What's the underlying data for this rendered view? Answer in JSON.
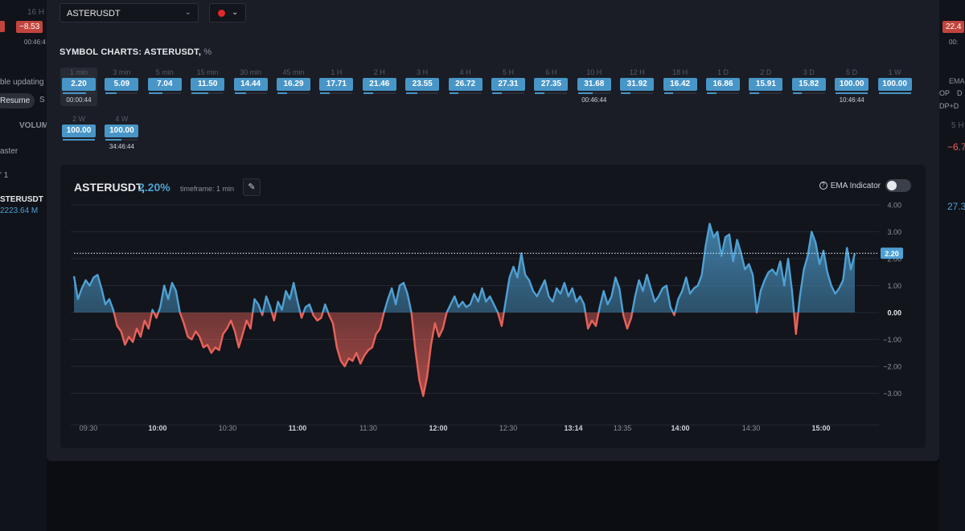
{
  "background": {
    "left": {
      "top_value": "16 H",
      "badge": "−8.53",
      "time": "00:46:4",
      "auto_update": "ble updating",
      "resume_label": "Resume",
      "s_label": "S",
      "volume_label": "VOLUM",
      "master_label": "aster",
      "row_label": "' 1",
      "symbol": "STERUSDT",
      "volume": "2223.64 M"
    },
    "right": {
      "badge": "22.4",
      "time": "00:",
      "ema_label": "EMA",
      "op_label": "OP",
      "d_label": "D",
      "dpd_label": "DP+D",
      "tf_label": "5 H",
      "neg_value": "−6.7",
      "pos_value": "27.3"
    }
  },
  "symbol_select": {
    "value": "ASTERUSDT"
  },
  "color_select": {
    "color": "#e02a2a"
  },
  "section": {
    "title": "SYMBOL CHARTS: ASTERUSDT,",
    "unit": "%"
  },
  "timeframes": [
    {
      "label": "1 min",
      "value": "2.20",
      "progress": 0.72,
      "time": "00:00:44",
      "active": true
    },
    {
      "label": "3 min",
      "value": "5.09",
      "progress": 0.35
    },
    {
      "label": "5 min",
      "value": "7.04",
      "progress": 0.42
    },
    {
      "label": "15 min",
      "value": "11.50",
      "progress": 0.52
    },
    {
      "label": "30 min",
      "value": "14.44",
      "progress": 0.36
    },
    {
      "label": "45 min",
      "value": "16.29",
      "progress": 0.3
    },
    {
      "label": "1 H",
      "value": "17.71",
      "progress": 0.28
    },
    {
      "label": "2 H",
      "value": "21.46",
      "progress": 0.3
    },
    {
      "label": "3 H",
      "value": "23.55",
      "progress": 0.35
    },
    {
      "label": "4 H",
      "value": "26.72",
      "progress": 0.28
    },
    {
      "label": "5 H",
      "value": "27.31",
      "progress": 0.3
    },
    {
      "label": "6 H",
      "value": "27.35",
      "progress": 0.3
    },
    {
      "label": "10 H",
      "value": "31.68",
      "progress": 0.45,
      "time": "00:46:44"
    },
    {
      "label": "12 H",
      "value": "31.92",
      "progress": 0.3
    },
    {
      "label": "18 H",
      "value": "16.42",
      "progress": 0.28
    },
    {
      "label": "1 D",
      "value": "16.86",
      "progress": 0.3
    },
    {
      "label": "2 D",
      "value": "15.91",
      "progress": 0.28
    },
    {
      "label": "3 D",
      "value": "15.82",
      "progress": 0.28
    },
    {
      "label": "5 D",
      "value": "100.00",
      "progress": 1.0,
      "time": "10:46:44"
    },
    {
      "label": "1 W",
      "value": "100.00",
      "progress": 1.0
    },
    {
      "label": "2 W",
      "value": "100.00",
      "progress": 1.0
    },
    {
      "label": "4 W",
      "value": "100.00",
      "progress": 0.5,
      "time": "34:46:44"
    }
  ],
  "panel": {
    "symbol": "ASTERUSDT,",
    "pct": "2.20%",
    "timeframe": "timeframe: 1 min",
    "ema_label": "EMA Indicator",
    "ema_on": false
  },
  "chart_data": {
    "type": "area",
    "title": "",
    "xlabel": "",
    "ylabel": "",
    "ylim": [
      -4,
      4
    ],
    "yticks": [
      "4.00",
      "3.00",
      "2.00",
      "1.00",
      "0.00",
      "−1.00",
      "−2.00",
      "−3.00"
    ],
    "ytick_values": [
      4,
      3,
      2,
      1,
      0,
      -1,
      -2,
      -3
    ],
    "xticks": [
      {
        "label": "09:30",
        "bold": false
      },
      {
        "label": "10:00",
        "bold": true
      },
      {
        "label": "10:30",
        "bold": false
      },
      {
        "label": "11:00",
        "bold": true
      },
      {
        "label": "11:30",
        "bold": false
      },
      {
        "label": "12:00",
        "bold": true
      },
      {
        "label": "12:30",
        "bold": false
      },
      {
        "label": "13:14",
        "bold": true
      },
      {
        "label": "13:35",
        "bold": false
      },
      {
        "label": "14:00",
        "bold": true
      },
      {
        "label": "14:30",
        "bold": false
      },
      {
        "label": "15:00",
        "bold": true
      }
    ],
    "current_value": 2.2,
    "current_label": "2.20",
    "positive_color": "#4fa0d3",
    "negative_color": "#e8625a",
    "grid": true,
    "values": [
      1.35,
      0.5,
      0.9,
      1.2,
      1.0,
      1.3,
      1.4,
      0.9,
      0.3,
      0.5,
      0.1,
      -0.5,
      -0.7,
      -1.2,
      -0.9,
      -1.1,
      -0.6,
      -0.9,
      -0.3,
      -0.6,
      0.1,
      -0.2,
      0.2,
      1.0,
      0.5,
      1.1,
      0.8,
      0.0,
      -0.4,
      -0.9,
      -1.0,
      -0.7,
      -0.9,
      -1.3,
      -1.2,
      -1.5,
      -1.3,
      -1.4,
      -0.8,
      -0.6,
      -0.3,
      -0.7,
      -1.3,
      -0.8,
      -0.3,
      -0.6,
      0.5,
      0.3,
      -0.1,
      0.6,
      0.2,
      -0.3,
      0.4,
      0.1,
      0.8,
      0.5,
      1.1,
      0.4,
      -0.2,
      0.2,
      0.3,
      -0.1,
      -0.3,
      -0.2,
      0.3,
      -0.1,
      -0.4,
      -1.3,
      -1.8,
      -2.0,
      -1.7,
      -1.8,
      -1.5,
      -1.9,
      -1.6,
      -1.4,
      -1.3,
      -0.8,
      -0.6,
      0.0,
      0.5,
      0.9,
      0.3,
      1.0,
      1.1,
      0.7,
      0.0,
      -1.4,
      -2.5,
      -3.1,
      -2.4,
      -1.2,
      -0.4,
      -0.9,
      -0.6,
      0.0,
      0.3,
      0.6,
      0.2,
      0.4,
      0.2,
      0.3,
      0.7,
      0.4,
      0.9,
      0.4,
      0.6,
      0.3,
      0.0,
      -0.5,
      0.4,
      1.3,
      1.7,
      1.3,
      2.2,
      1.4,
      1.2,
      0.8,
      0.6,
      0.9,
      1.2,
      0.6,
      0.4,
      0.9,
      0.7,
      1.1,
      0.6,
      0.9,
      0.4,
      0.6,
      0.3,
      -0.6,
      -0.3,
      -0.5,
      0.2,
      0.8,
      0.3,
      0.6,
      1.3,
      0.9,
      -0.1,
      -0.6,
      -0.2,
      0.6,
      1.2,
      0.8,
      1.4,
      0.9,
      0.4,
      0.6,
      0.9,
      1.0,
      0.2,
      -0.1,
      0.5,
      0.8,
      1.3,
      0.7,
      0.9,
      1.0,
      1.4,
      2.5,
      3.3,
      2.8,
      3.0,
      2.1,
      2.8,
      2.9,
      1.9,
      2.7,
      2.2,
      1.6,
      1.8,
      1.4,
      0.0,
      0.8,
      1.2,
      1.5,
      1.6,
      1.4,
      1.9,
      1.0,
      2.0,
      0.8,
      -0.8,
      0.6,
      1.6,
      2.1,
      3.0,
      2.6,
      1.8,
      2.3,
      1.5,
      1.0,
      0.7,
      0.9,
      1.2,
      2.4,
      1.6,
      2.2
    ]
  }
}
